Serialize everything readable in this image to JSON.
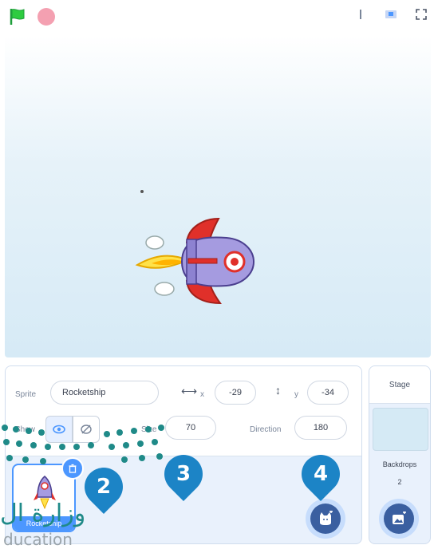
{
  "toolbar": {
    "green_flag_icon": "green-flag-icon",
    "stop_icon": "stop-icon",
    "layout_icons": [
      "small-stage-icon",
      "large-stage-icon",
      "fullscreen-icon"
    ]
  },
  "sprite_info": {
    "sprite_label": "Sprite",
    "sprite_name": "Rocketship",
    "x_label": "x",
    "x_value": "-29",
    "y_label": "y",
    "y_value": "-34",
    "show_label": "Show",
    "size_label": "Size",
    "size_value": "70",
    "direction_label": "Direction",
    "direction_value": "180"
  },
  "sprite_list": [
    {
      "name": "Rocketship",
      "selected": true
    }
  ],
  "stage_panel": {
    "title": "Stage",
    "backdrops_label": "Backdrops",
    "backdrops_count": "2"
  },
  "callouts": [
    "2",
    "3",
    "4"
  ],
  "watermark": {
    "text": "وزارة ال",
    "subtext": "ducation"
  },
  "colors": {
    "accent": "#4c97ff",
    "callout": "#1c84c6",
    "flag": "#2ecc40",
    "stop": "#f4a0b1"
  }
}
